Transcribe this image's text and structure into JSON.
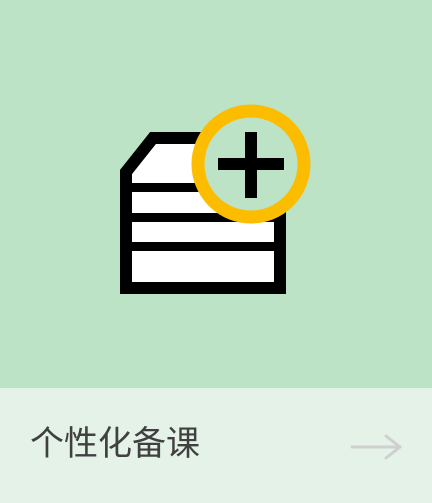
{
  "card": {
    "label": "个性化备课",
    "icon": "document-stack-add-icon",
    "arrow_icon": "arrow-right-icon"
  },
  "colors": {
    "hero_background": "#bce3c6",
    "footer_background": "#e5f2e8",
    "label_text": "#404040",
    "icon_outline": "#000000",
    "icon_fill": "#ffffff",
    "plus_badge_ring": "#fcbc00",
    "plus_sign": "#000000",
    "arrow": "#cfcfcf"
  }
}
